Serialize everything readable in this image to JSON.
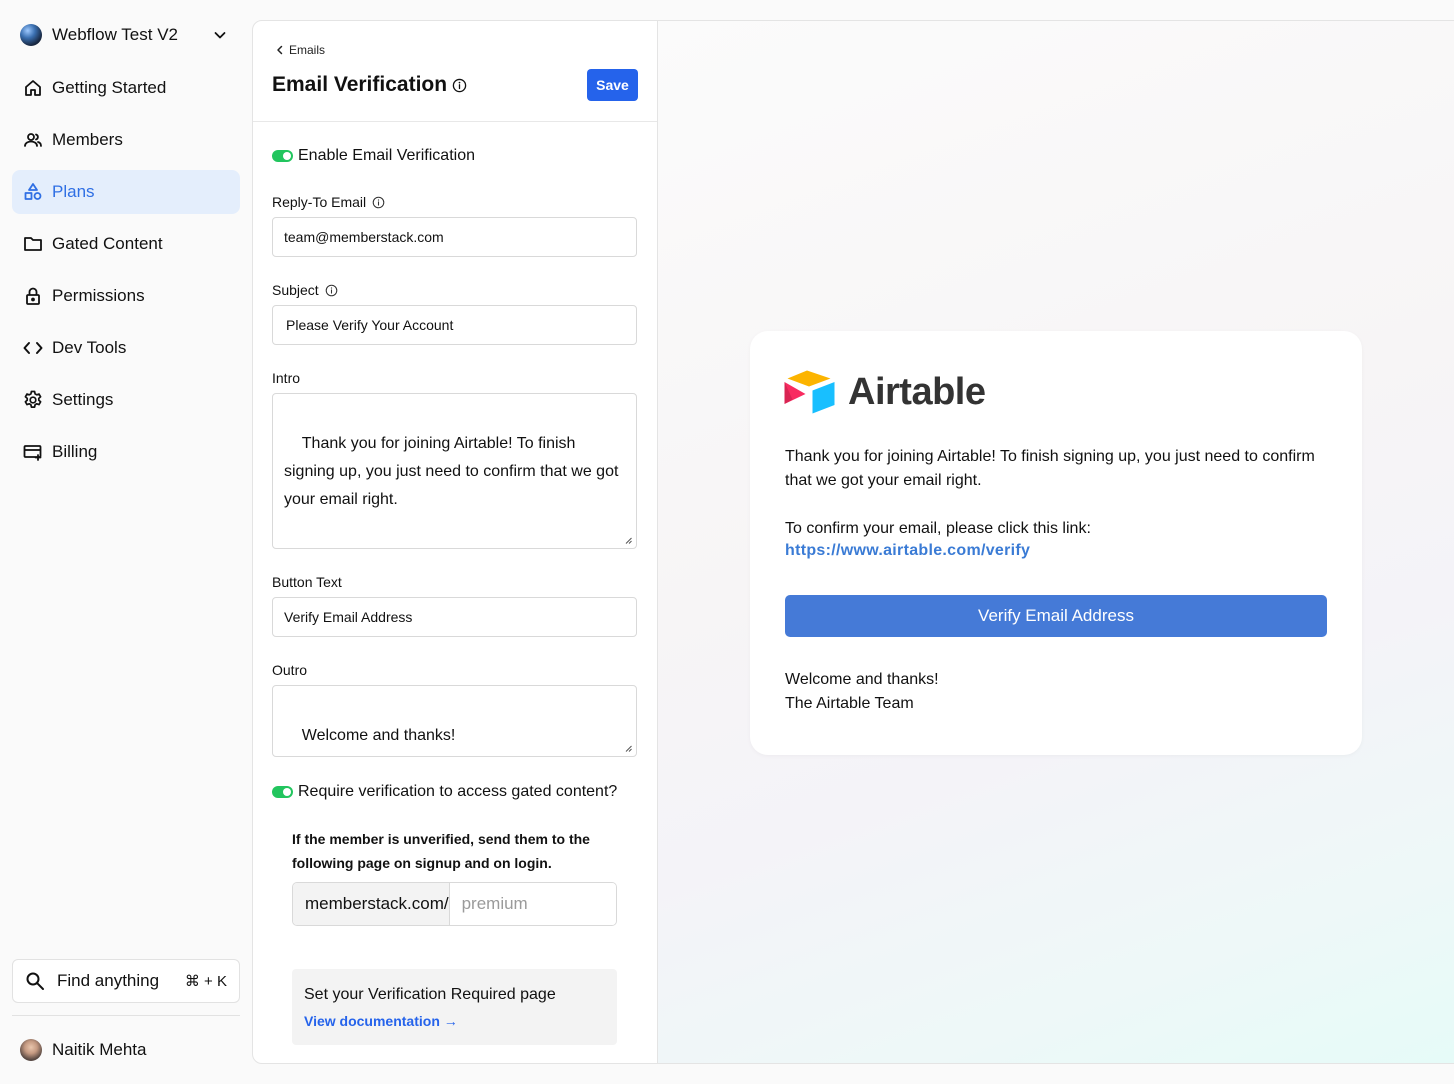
{
  "sidebar": {
    "workspace": "Webflow Test V2",
    "items": [
      {
        "label": "Getting Started",
        "icon": "home-icon"
      },
      {
        "label": "Members",
        "icon": "members-icon"
      },
      {
        "label": "Plans",
        "icon": "plans-icon",
        "active": true
      },
      {
        "label": "Gated Content",
        "icon": "folder-icon"
      },
      {
        "label": "Permissions",
        "icon": "lock-icon"
      },
      {
        "label": "Dev Tools",
        "icon": "code-icon"
      },
      {
        "label": "Settings",
        "icon": "gear-icon"
      },
      {
        "label": "Billing",
        "icon": "credit-card-icon"
      }
    ],
    "find": {
      "label": "Find anything",
      "shortcut": "⌘ + K"
    },
    "user": "Naitik Mehta"
  },
  "editor": {
    "back": "Emails",
    "title": "Email Verification",
    "save": "Save",
    "enable_toggle": "Enable Email Verification",
    "reply_to_label": "Reply-To Email",
    "reply_to_value": "team@memberstack.com",
    "subject_label": "Subject",
    "subject_value": "Please Verify Your Account",
    "intro_label": "Intro",
    "intro_value": "Thank you for joining Airtable! To finish signing up, you just need to confirm that we got your email right.\n\nTo confirm your email, please click this link:",
    "button_text_label": "Button Text",
    "button_text_value": "Verify Email Address",
    "outro_label": "Outro",
    "outro_value": "Welcome and thanks!\nThe Airtable Team",
    "require_toggle": "Require verification to access gated content?",
    "unverified_note": "If the member is unverified, send them to the following page on signup and on login.",
    "url_prefix": "memberstack.com/",
    "url_placeholder": "premium",
    "doc_title": "Set your Verification Required page",
    "doc_link": "View documentation →"
  },
  "preview": {
    "brand": "Airtable",
    "intro": "Thank you for joining Airtable! To finish signing up, you just need to confirm that we got your email right.",
    "confirm": "To confirm your email, please click this link:",
    "url": "https://www.airtable.com/verify",
    "button": "Verify Email Address",
    "outro": "Welcome and thanks!\nThe Airtable Team"
  },
  "colors": {
    "accent": "#2563eb",
    "toggle_on": "#22c55e",
    "active_nav_bg": "#e4eefc",
    "preview_button": "#457ad7"
  }
}
